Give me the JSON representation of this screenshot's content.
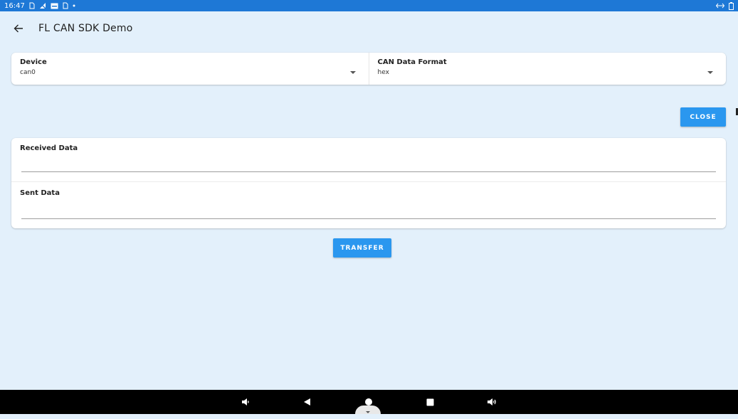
{
  "status_bar": {
    "time": "16:47",
    "left_icons": [
      "sim-icon",
      "no-signal-icon",
      "notification-icon",
      "sim-icon",
      "dot-icon"
    ],
    "right_icons": [
      "data-arrows-icon",
      "battery-icon"
    ],
    "color": "#1e78d6"
  },
  "app_bar": {
    "back_icon": "arrow-left-icon",
    "title": "FL CAN SDK Demo"
  },
  "selectors": {
    "device": {
      "label": "Device",
      "value": "can0"
    },
    "format": {
      "label": "CAN Data Format",
      "value": "hex"
    }
  },
  "buttons": {
    "close": "CLOSE",
    "transfer": "TRANSFER",
    "color": "#2a97ef"
  },
  "data": {
    "received_label": "Received Data",
    "received_value": "",
    "sent_label": "Sent Data",
    "sent_value": ""
  },
  "nav_bar": {
    "items": [
      "volume-down-icon",
      "back-triangle-icon",
      "home-circle-icon",
      "recents-square-icon",
      "volume-up-icon"
    ]
  }
}
